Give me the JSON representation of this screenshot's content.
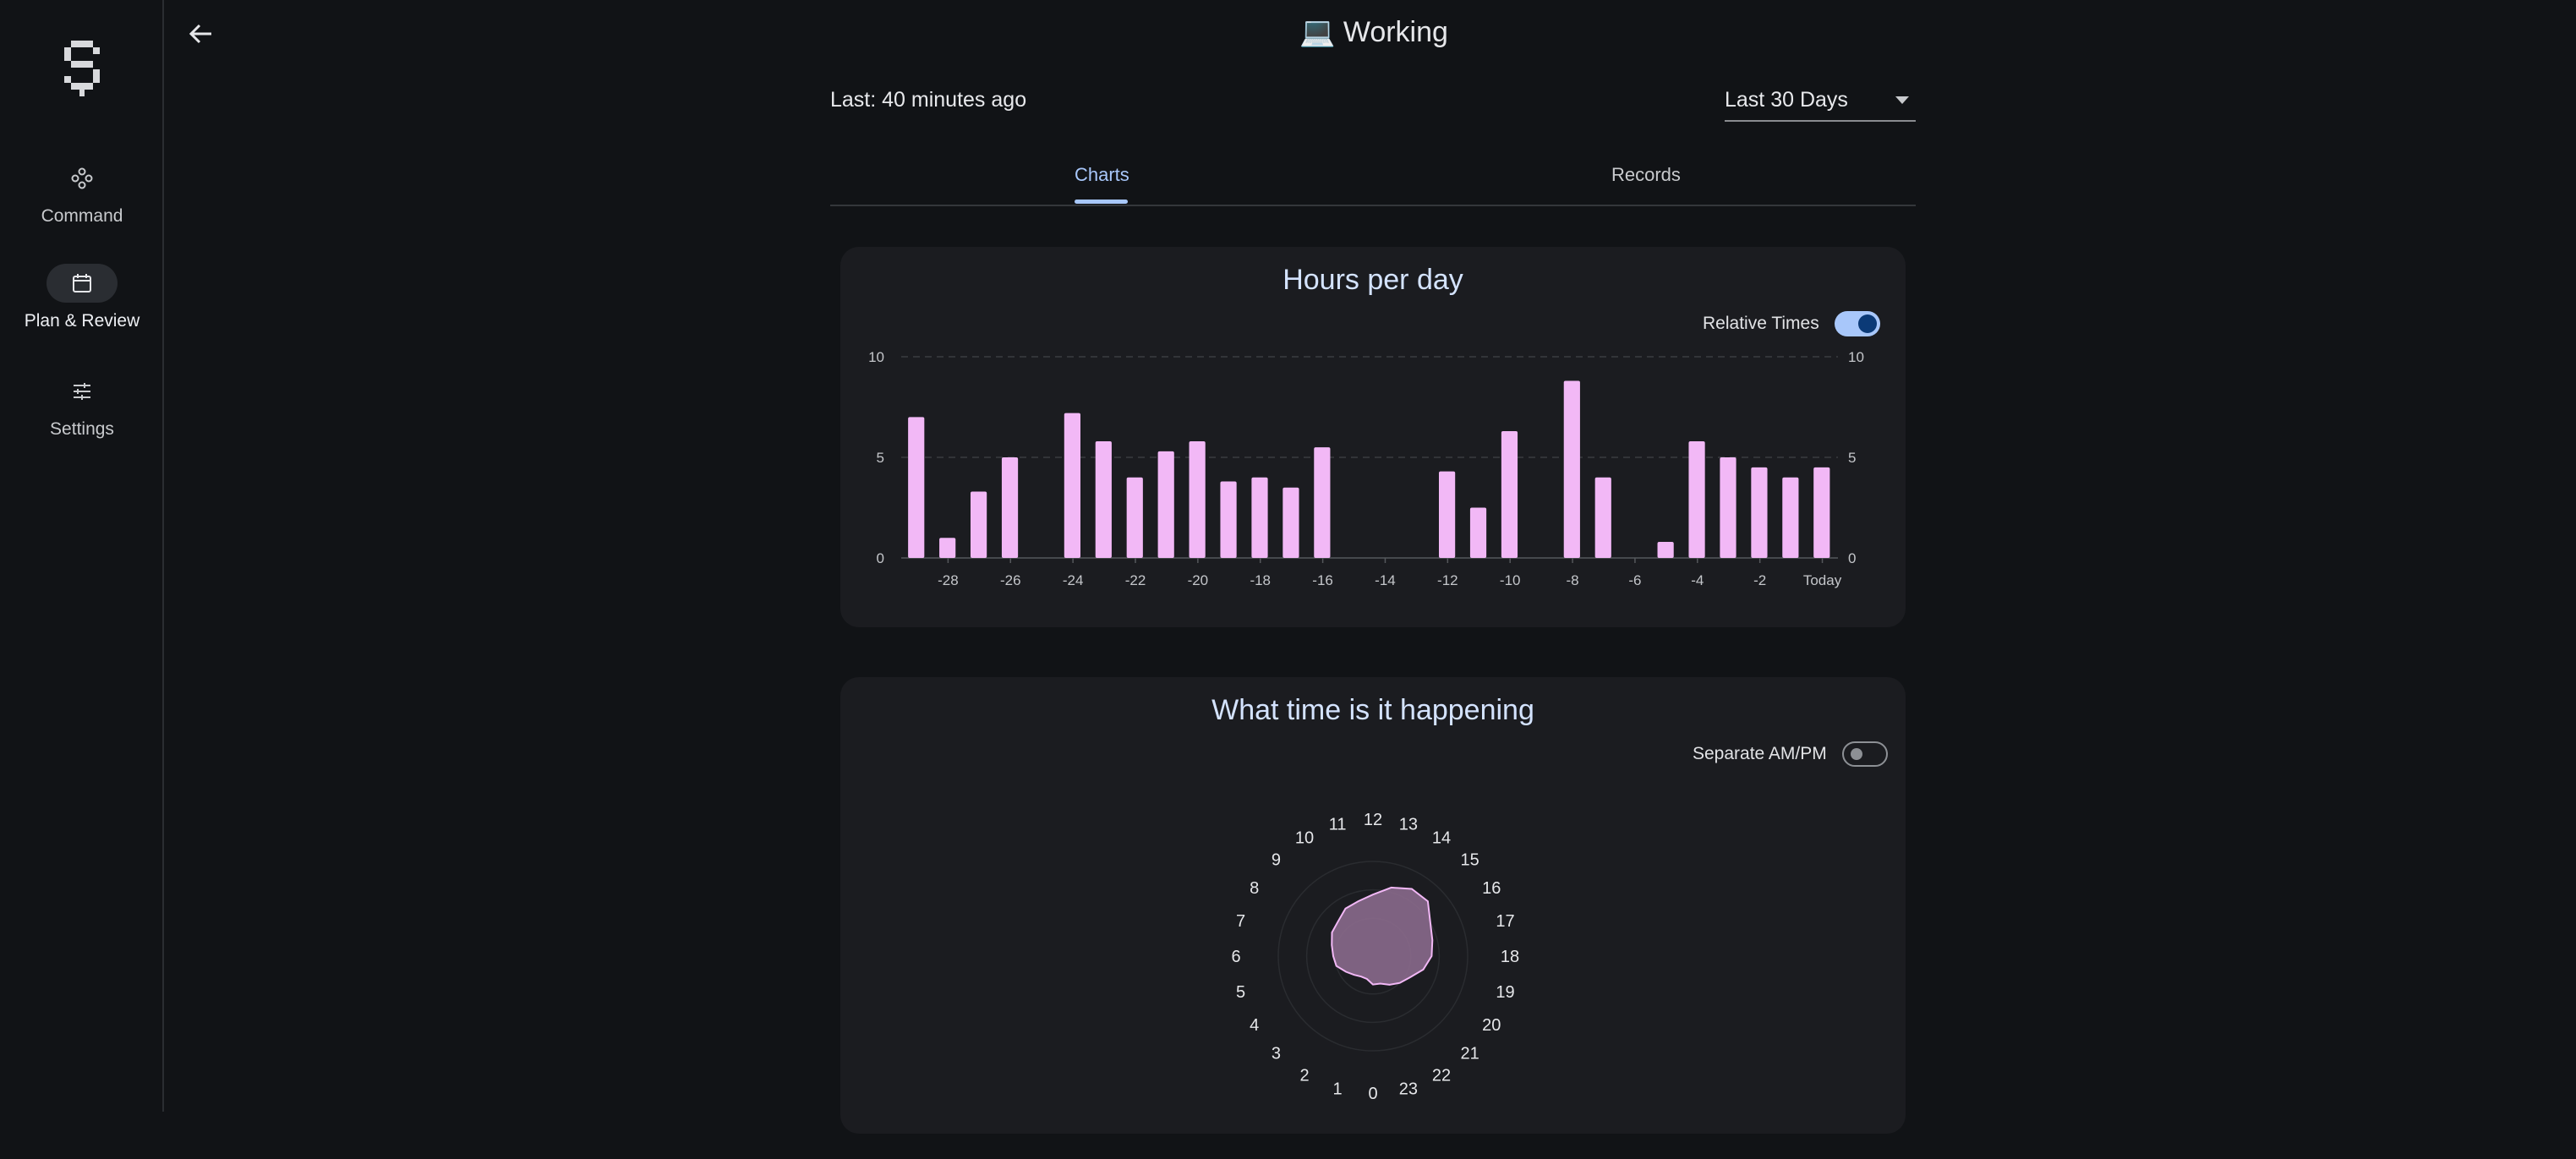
{
  "sidebar": {
    "items": [
      {
        "label": "Command",
        "icon": "command-joystick-icon"
      },
      {
        "label": "Plan & Review",
        "icon": "calendar-icon",
        "active": true
      },
      {
        "label": "Settings",
        "icon": "sliders-icon"
      }
    ]
  },
  "header": {
    "title": "💻 Working",
    "last_seen": "Last: 40 minutes ago",
    "range_select": {
      "value": "Last 30 Days"
    }
  },
  "tabs": [
    {
      "label": "Charts",
      "active": true
    },
    {
      "label": "Records",
      "active": false
    }
  ],
  "hours_card": {
    "title": "Hours per day",
    "toggle_label": "Relative Times",
    "toggle_on": true
  },
  "time_card": {
    "title": "What time is it happening",
    "toggle_label": "Separate AM/PM",
    "toggle_on": false
  },
  "colors": {
    "accent": "#a8c7fa",
    "bar": "#f2b8f6",
    "radar_fill": "#8a6a8c",
    "radar_stroke": "#f2b8f6"
  },
  "chart_data": [
    {
      "type": "bar",
      "title": "Hours per day",
      "x": [
        -29,
        -28,
        -27,
        -26,
        -25,
        -24,
        -23,
        -22,
        -21,
        -20,
        -19,
        -18,
        -17,
        -16,
        -15,
        -14,
        -13,
        -12,
        -11,
        -10,
        -9,
        -8,
        -7,
        -6,
        -5,
        -4,
        -3,
        -2,
        -1,
        0
      ],
      "values": [
        7.0,
        1.0,
        3.3,
        5.0,
        0,
        7.2,
        5.8,
        4.0,
        5.3,
        5.8,
        3.8,
        4.0,
        3.5,
        5.5,
        0,
        0,
        0,
        4.3,
        2.5,
        6.3,
        0,
        8.8,
        4.0,
        0,
        0.8,
        5.8,
        5.0,
        4.5,
        4.0,
        4.5
      ],
      "x_tick_labels": [
        "-28",
        "-26",
        "-24",
        "-22",
        "-20",
        "-18",
        "-16",
        "-14",
        "-12",
        "-10",
        "-8",
        "-6",
        "-4",
        "-2",
        "Today"
      ],
      "x_tick_values": [
        -28,
        -26,
        -24,
        -22,
        -20,
        -18,
        -16,
        -14,
        -12,
        -10,
        -8,
        -6,
        -4,
        -2,
        0
      ],
      "y_ticks": [
        0,
        5,
        10
      ],
      "ylim": [
        0,
        10
      ],
      "grid": true,
      "y_axis_both_sides": true
    },
    {
      "type": "radar",
      "title": "What time is it happening",
      "categories": [
        "0",
        "1",
        "2",
        "3",
        "4",
        "5",
        "6",
        "7",
        "8",
        "9",
        "10",
        "11",
        "12",
        "13",
        "14",
        "15",
        "16",
        "17",
        "18",
        "19",
        "20",
        "21",
        "22",
        "23"
      ],
      "values": [
        0.3,
        0.25,
        0.25,
        0.28,
        0.33,
        0.4,
        0.42,
        0.45,
        0.5,
        0.52,
        0.58,
        0.6,
        0.65,
        0.75,
        0.82,
        0.82,
        0.7,
        0.65,
        0.62,
        0.55,
        0.45,
        0.4,
        0.35,
        0.3
      ],
      "rmax": 1.0
    }
  ]
}
